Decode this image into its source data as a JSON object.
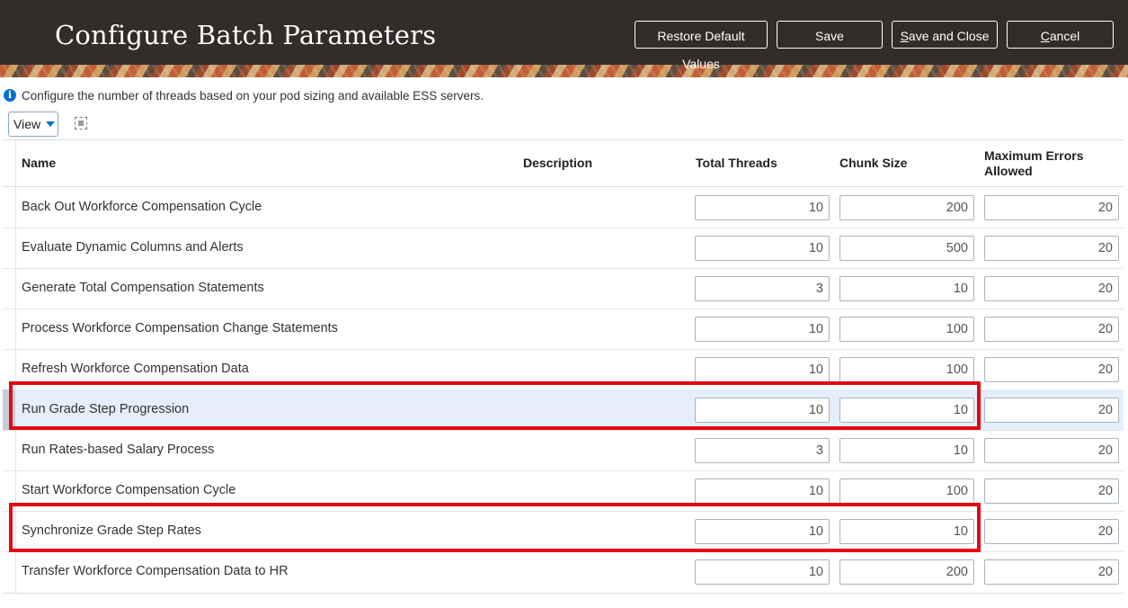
{
  "header": {
    "title": "Configure Batch Parameters",
    "buttons": {
      "restore": "Restore Default Values",
      "save": "Save",
      "save_and_close_prefix": "S",
      "save_and_close_rest": "ave and Close",
      "cancel_prefix": "C",
      "cancel_rest": "ancel"
    }
  },
  "info": {
    "icon": "info-icon",
    "text": "Configure the number of threads based on your pod sizing and available ESS servers."
  },
  "toolbar": {
    "view_label": "View",
    "detach_icon": "detach-icon"
  },
  "table": {
    "columns": {
      "name": "Name",
      "description": "Description",
      "total_threads": "Total Threads",
      "chunk_size": "Chunk Size",
      "max_errors_line1": "Maximum Errors",
      "max_errors_line2": "Allowed"
    },
    "rows": [
      {
        "name": "Back Out Workforce Compensation Cycle",
        "threads": "10",
        "chunk": "200",
        "errors": "20"
      },
      {
        "name": "Evaluate Dynamic Columns and Alerts",
        "threads": "10",
        "chunk": "500",
        "errors": "20"
      },
      {
        "name": "Generate Total Compensation Statements",
        "threads": "3",
        "chunk": "10",
        "errors": "20"
      },
      {
        "name": "Process Workforce Compensation Change Statements",
        "threads": "10",
        "chunk": "100",
        "errors": "20"
      },
      {
        "name": "Refresh Workforce Compensation Data",
        "threads": "10",
        "chunk": "100",
        "errors": "20"
      },
      {
        "name": "Run Grade Step Progression",
        "threads": "10",
        "chunk": "10",
        "errors": "20"
      },
      {
        "name": "Run Rates-based Salary Process",
        "threads": "3",
        "chunk": "10",
        "errors": "20"
      },
      {
        "name": "Start Workforce Compensation Cycle",
        "threads": "10",
        "chunk": "100",
        "errors": "20"
      },
      {
        "name": "Synchronize Grade Step Rates",
        "threads": "10",
        "chunk": "10",
        "errors": "20"
      },
      {
        "name": "Transfer Workforce Compensation Data to HR",
        "threads": "10",
        "chunk": "200",
        "errors": "20"
      }
    ],
    "selected_row": "Run Grade Step Progression",
    "highlight_color": "#e30613"
  }
}
